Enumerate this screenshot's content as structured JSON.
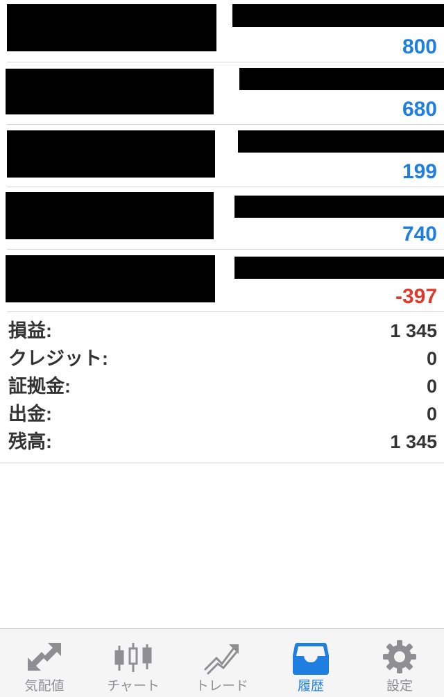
{
  "deals": [
    {
      "profit": "800"
    },
    {
      "profit": "680"
    },
    {
      "profit": "199"
    },
    {
      "profit": "740"
    },
    {
      "profit": "-397"
    }
  ],
  "summary": {
    "profit_label": "損益:",
    "profit_value": "1 345",
    "credit_label": "クレジット:",
    "credit_value": "0",
    "margin_label": "証拠金:",
    "margin_value": "0",
    "withdrawal_label": "出金:",
    "withdrawal_value": "0",
    "balance_label": "残高:",
    "balance_value": "1 345"
  },
  "tabbar": {
    "quotes": {
      "label": "気配値",
      "icon": "quotes-arrows-icon"
    },
    "chart": {
      "label": "チャート",
      "icon": "candlestick-chart-icon"
    },
    "trade": {
      "label": "トレード",
      "icon": "trade-trend-icon"
    },
    "history": {
      "label": "履歴",
      "icon": "inbox-tray-icon"
    },
    "settings": {
      "label": "設定",
      "icon": "gear-icon"
    }
  },
  "colors": {
    "positive": "#1f7fe0",
    "negative": "#e03a2e",
    "text": "#333333",
    "tab_active": "#1f7fe0",
    "tab_inactive": "#8e8e93"
  }
}
